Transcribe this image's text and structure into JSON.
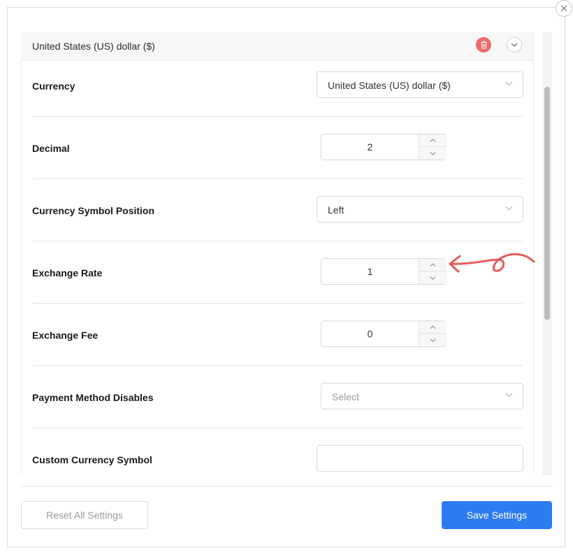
{
  "panel": {
    "title": "United States (US) dollar ($)"
  },
  "fields": {
    "currency": {
      "label": "Currency",
      "value": "United States (US) dollar ($)"
    },
    "decimal": {
      "label": "Decimal",
      "value": "2"
    },
    "symbol_position": {
      "label": "Currency Symbol Position",
      "value": "Left"
    },
    "exchange_rate": {
      "label": "Exchange Rate",
      "value": "1"
    },
    "exchange_fee": {
      "label": "Exchange Fee",
      "value": "0"
    },
    "payment_method_disables": {
      "label": "Payment Method Disables",
      "placeholder": "Select"
    },
    "custom_symbol": {
      "label": "Custom Currency Symbol",
      "value": ""
    }
  },
  "footer": {
    "reset_label": "Reset All Settings",
    "save_label": "Save Settings"
  },
  "colors": {
    "primary": "#2d7bf0",
    "delete": "#ee6a6a",
    "annotation": "#e85a5a"
  },
  "icons": {
    "close": "close-icon",
    "delete": "trash-icon",
    "collapse": "chevron-down-icon",
    "select": "chevron-down-icon",
    "step_up": "chevron-up-icon",
    "step_down": "chevron-down-icon"
  }
}
